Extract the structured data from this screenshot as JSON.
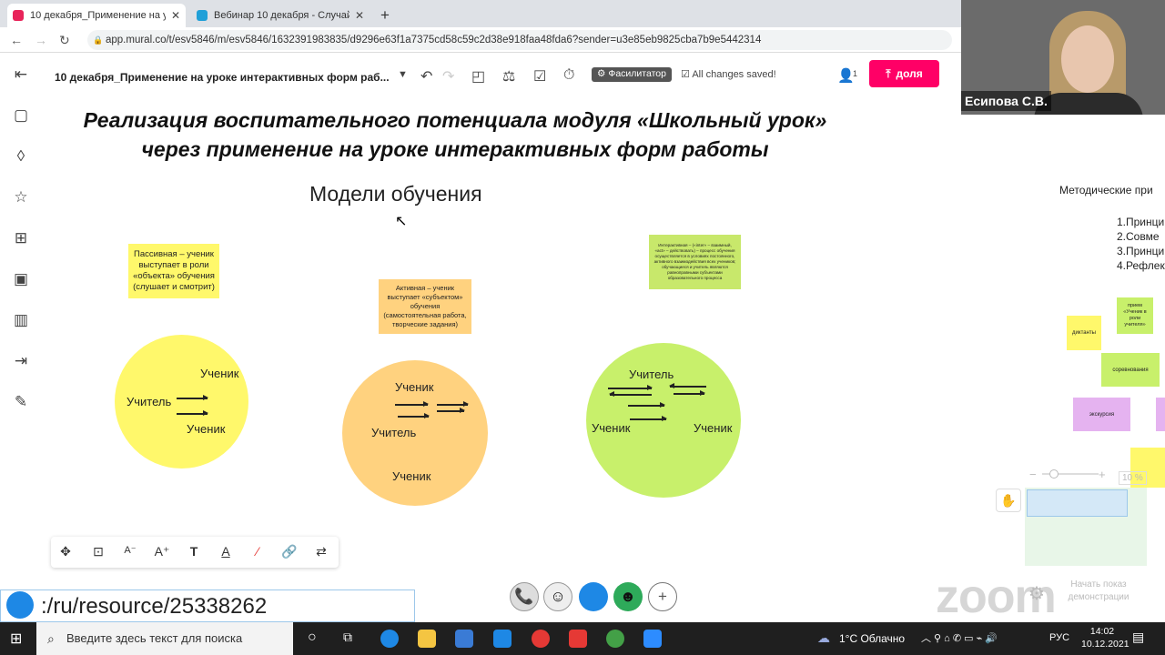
{
  "browser": {
    "tabs": [
      {
        "label": "10 декабря_Применение на уро",
        "color": "#e8245a"
      },
      {
        "label": "Вебинар 10 декабря - Случайн",
        "color": "#20a0d8"
      }
    ],
    "url": "app.mural.co/t/esv5846/m/esv5846/1632391983835/d9296e63f1a7375cd58c59c2d38e918faa48fda6?sender=u3e85eb9825cba7b9e5442314"
  },
  "toolbar": {
    "board_title": "10 декабря_Применение на уроке интерактивных форм раб...",
    "facilitator": "Фасилитатор",
    "saved": "All changes saved!",
    "users": "1",
    "share": "доля"
  },
  "canvas": {
    "heading_line1": "Реализация воспитательного потенциала модуля «Школьный урок»",
    "heading_line2": "через применение на уроке интерактивных форм работы",
    "models_title": "Модели обучения",
    "sticky_passive": "Пассивная – ученик выступает в роли «объекта» обучения (слушает и смотрит)",
    "sticky_active": "Активная – ученик выступает «субъектом» обучения (самостоятельная работа, творческие задания)",
    "sticky_interactive": "Интерактивная – («inter» – взаимный, «act» – действовать) – процесс обучения осуществляется в условиях постоянного, активного взаимодействия всех учеников; обучающиеся и учитель являются равноправными субъектами образовательного процесса",
    "c1": {
      "teacher": "Учитель",
      "student1": "Ученик",
      "student2": "Ученик"
    },
    "c2": {
      "student1": "Ученик",
      "teacher": "Учитель",
      "student2": "Ученик"
    },
    "c3": {
      "teacher": "Учитель",
      "student1": "Ученик",
      "student2": "Ученик"
    },
    "right_title": "Методические при",
    "right_list": [
      "1.Принци",
      "2.Совме",
      "3.Принци",
      "4.Рефлек"
    ],
    "right_stickies": [
      "прием «Ученик в роли учителя»",
      "диктанты",
      "соревнования",
      "экскурсия",
      "10 %"
    ]
  },
  "zoom_control": {
    "minus": "−",
    "plus": "+",
    "value": "10 %"
  },
  "resource_url": ":/ru/resource/25338262",
  "video": {
    "name": "Есипова С.В."
  },
  "zoom_logo": "zoom",
  "zoom_overlay": "Начать показ демонстрации",
  "taskbar": {
    "search_placeholder": "Введите здесь текст для поиска",
    "weather": "1°C Облачно",
    "lang": "РУС",
    "time": "14:02",
    "date": "10.12.2021"
  }
}
